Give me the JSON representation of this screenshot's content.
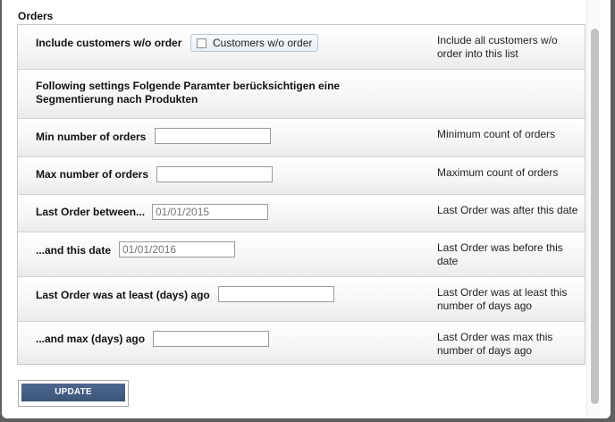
{
  "section": {
    "title": "Orders"
  },
  "rows": [
    {
      "label": "Include customers w/o order",
      "toggle_label": "Customers w/o order",
      "help": "Include all customers w/o order into this list"
    },
    {
      "label": "Following settings Folgende Paramter berücksichtigen eine Segmentierung nach Produkten"
    },
    {
      "label": "Min number of orders",
      "value": "",
      "help": "Minimum count of orders"
    },
    {
      "label": "Max number of orders",
      "value": "",
      "help": "Maximum count of orders"
    },
    {
      "label": "Last Order between...",
      "placeholder": "01/01/2015",
      "help": "Last Order was after this date"
    },
    {
      "label": "...and this date",
      "placeholder": "01/01/2016",
      "help": "Last Order was before this date"
    },
    {
      "label": "Last Order was at least (days) ago",
      "value": "",
      "help": "Last Order was at least this number of days ago"
    },
    {
      "label": "...and max (days) ago",
      "value": "",
      "help": "Last Order was max this number of days ago"
    }
  ],
  "button": {
    "label": "UPDATE"
  }
}
